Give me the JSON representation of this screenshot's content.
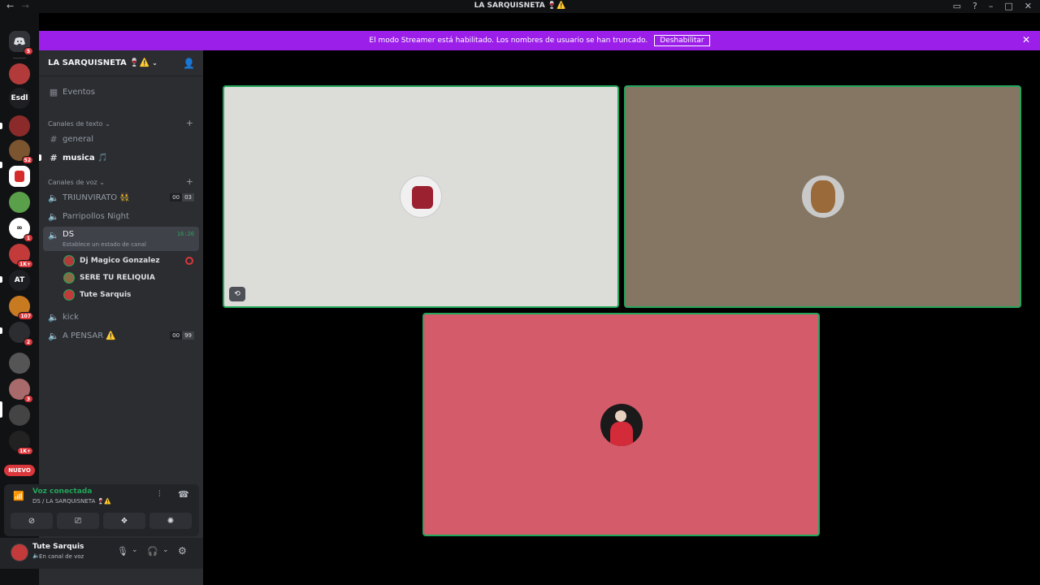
{
  "window": {
    "title": "LA SARQUISNETA 🍷⚠️",
    "back_icon": "←",
    "forward_icon": "→",
    "controls": [
      "inbox-icon",
      "help-icon",
      "minimize-icon",
      "maximize-icon",
      "close-icon"
    ]
  },
  "banner": {
    "text": "El modo Streamer está habilitado. Los nombres de usuario se han truncado.",
    "button": "Deshabilitar",
    "bg": "#9b1fe8"
  },
  "servers": {
    "home_badge": "5",
    "items": [
      {
        "label": "",
        "badge": ""
      },
      {
        "label": "Esdl",
        "badge": ""
      },
      {
        "label": "",
        "badge": ""
      },
      {
        "label": "",
        "badge": "52"
      },
      {
        "label": "",
        "badge": ""
      },
      {
        "label": "",
        "badge": ""
      },
      {
        "label": "",
        "badge": "1"
      },
      {
        "label": "",
        "badge": "1K+"
      },
      {
        "label": "AT",
        "badge": ""
      },
      {
        "label": "",
        "badge": "107"
      },
      {
        "label": "",
        "badge": "2"
      },
      {
        "label": "",
        "badge": ""
      },
      {
        "label": "",
        "badge": "3"
      },
      {
        "label": "",
        "badge": ""
      },
      {
        "label": "",
        "badge": "1K+"
      }
    ],
    "new_label": "NUEVO"
  },
  "guild": {
    "name": "LA SARQUISNETA 🍷⚠️",
    "events": "Eventos",
    "text_category": "Canales de texto",
    "voice_category": "Canales de voz",
    "text_channels": [
      "general",
      "musica 🎵"
    ],
    "voice_channels": [
      {
        "name": "TRIUNVIRATO 👯",
        "c1": "00",
        "c2": "03"
      },
      {
        "name": "Parripollos Night"
      },
      {
        "name": "DS",
        "time": "16:26",
        "status": "Establece un estado de canal"
      },
      {
        "name": "kick"
      },
      {
        "name": "A PENSAR ⚠️",
        "c1": "00",
        "c2": "99"
      }
    ],
    "members": [
      "Dj Magico Gonzalez",
      "SERE TU RELIQUIA",
      "Tute Sarquis"
    ]
  },
  "voice_panel": {
    "status": "Voz conectada",
    "location": "DS / LA SARQUISNETA 🍷⚠️"
  },
  "user": {
    "name": "Tute Sarquis",
    "status": "En canal de voz"
  },
  "colors": {
    "speaking_border": "#23a55a",
    "tile1": "#dcdcd8",
    "tile2": "#857664",
    "tile3": "#d45b6a"
  }
}
